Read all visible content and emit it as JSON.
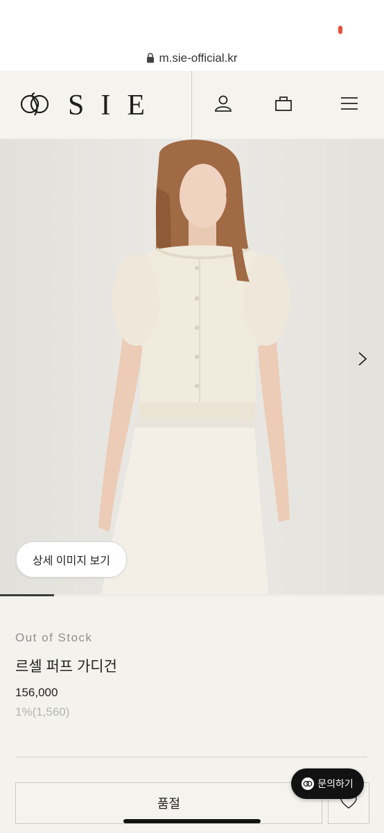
{
  "browser": {
    "url": "m.sie-official.kr"
  },
  "header": {
    "brand": "SIE",
    "icons": [
      "sie-logo-mark",
      "user-icon",
      "bag-icon",
      "menu-icon"
    ]
  },
  "gallery": {
    "detail_button": "상세 이미지 보기",
    "progress_fraction": 0.14
  },
  "product": {
    "stock_status": "Out of Stock",
    "name": "르셀 퍼프 가디건",
    "price": "156,000",
    "points": "1%(1,560)"
  },
  "actions": {
    "soldout_label": "품절",
    "inquiry_label": "문의하기"
  },
  "colors": {
    "background": "#f3f2ed",
    "accent": "#121212",
    "muted": "#8f8f8f",
    "recording_dot": "#e8503a"
  }
}
